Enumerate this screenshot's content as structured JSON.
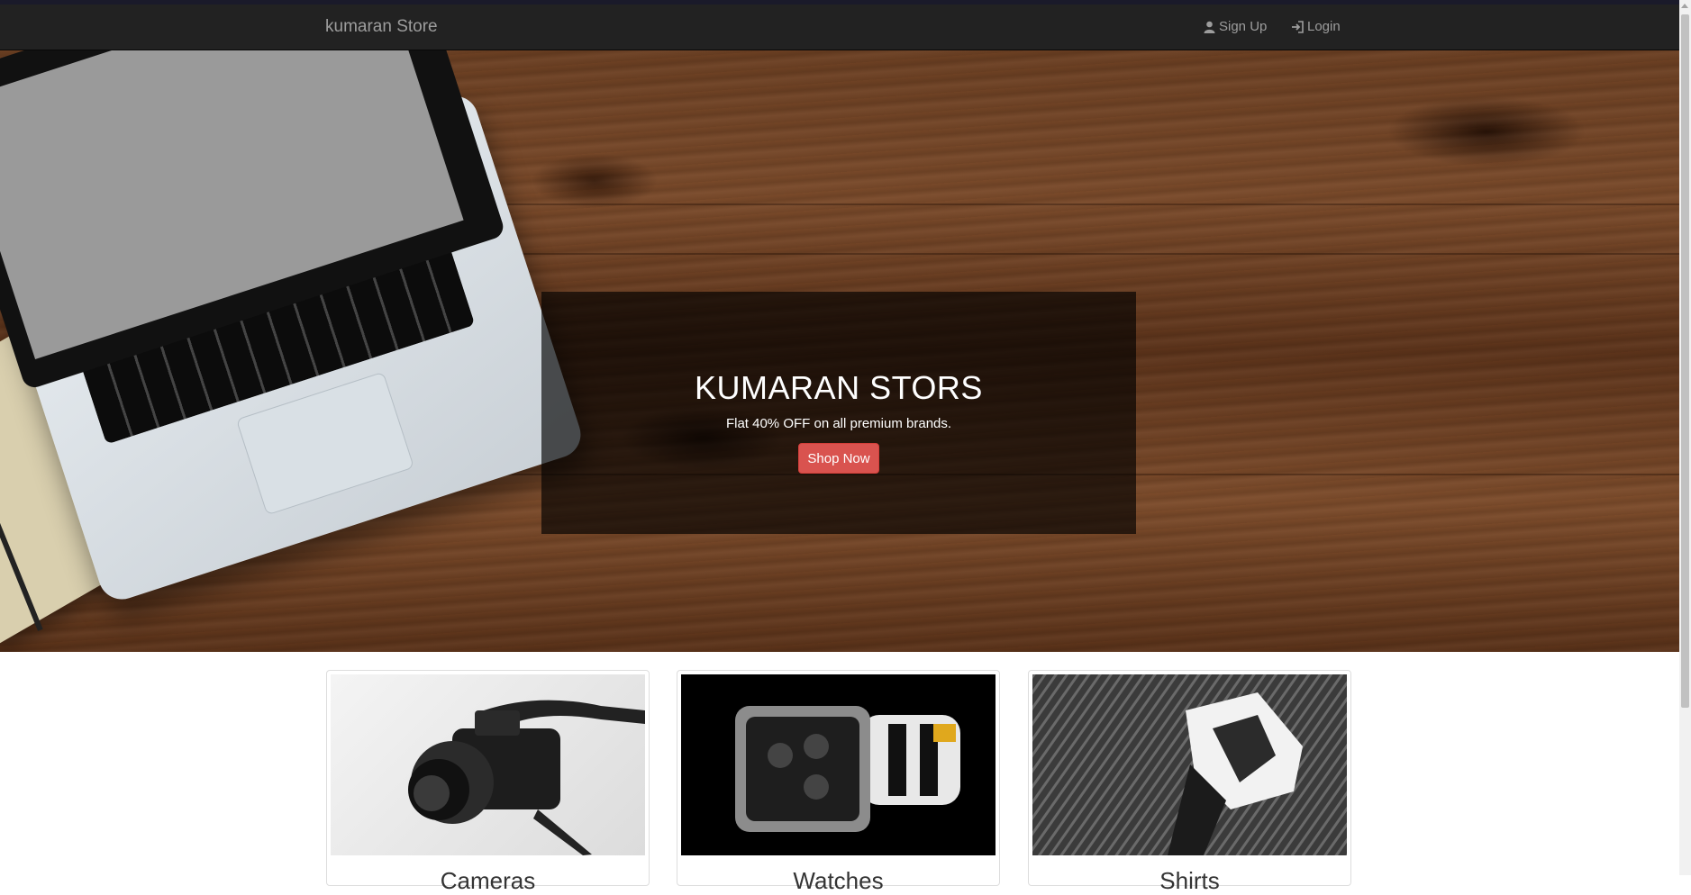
{
  "navbar": {
    "brand": "kumaran Store",
    "signup_label": "Sign Up",
    "login_label": "Login"
  },
  "hero": {
    "title": "KUMARAN STORS",
    "subtitle": "Flat 40% OFF on all premium brands.",
    "button_label": "Shop Now"
  },
  "products": [
    {
      "caption": "Cameras",
      "image_icon": "camera-photo"
    },
    {
      "caption": "Watches",
      "image_icon": "watch-photo"
    },
    {
      "caption": "Shirts",
      "image_icon": "shirt-photo"
    }
  ],
  "colors": {
    "navbar_bg": "#222222",
    "navbar_text": "#9d9d9d",
    "button_danger": "#d9534f",
    "overlay": "rgba(0,0,0,0.65)"
  }
}
